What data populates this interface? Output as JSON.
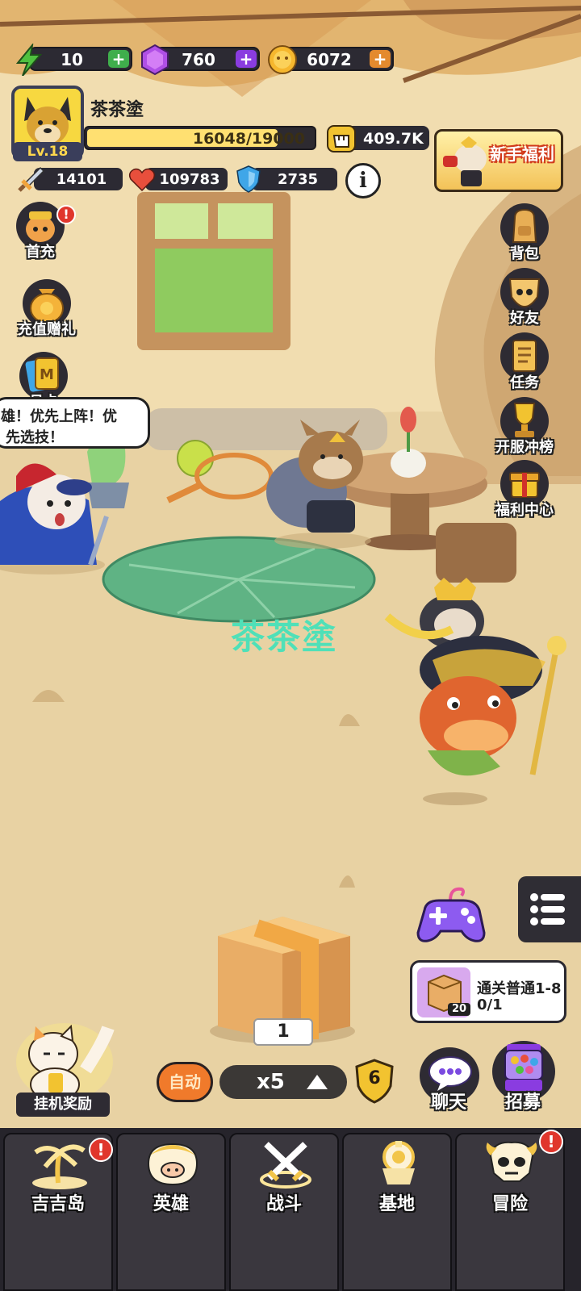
{
  "resources": {
    "energy": {
      "value": "10",
      "icon": "lightning-icon",
      "plus_color": "#3fae4c"
    },
    "gems": {
      "value": "760",
      "icon": "purple-gem-icon",
      "plus_color": "#8a3ce0"
    },
    "coins": {
      "value": "6072",
      "icon": "gold-coin-icon",
      "plus_color": "#e48a2e"
    },
    "plus": "+"
  },
  "player": {
    "name": "茶茶塗",
    "level": "Lv.18",
    "xp_text": "16048/19000",
    "xp_current": 16048,
    "xp_max": 19000,
    "power": "409.7K",
    "attack": "14101",
    "hp": "109783",
    "defense": "2735",
    "info": "i"
  },
  "newbie_banner": "新手福利",
  "left_menu": [
    {
      "label": "首充",
      "icon": "first-charge-icon",
      "alert": "!"
    },
    {
      "label": "充值赠礼",
      "icon": "money-bag-icon"
    },
    {
      "label": "月卡",
      "icon": "month-card-icon",
      "card_letter": "M"
    }
  ],
  "right_menu": [
    {
      "label": "背包",
      "icon": "backpack-icon"
    },
    {
      "label": "好友",
      "icon": "friends-icon"
    },
    {
      "label": "任务",
      "icon": "tasks-icon"
    },
    {
      "label": "开服冲榜",
      "icon": "trophy-icon"
    },
    {
      "label": "福利中心",
      "icon": "gift-icon"
    }
  ],
  "speech": {
    "line1": "雄！优先上阵！优",
    "line2": "先选技！"
  },
  "center_name": "茶茶塗",
  "crate": {
    "count": "1"
  },
  "controls": {
    "auto": "自动",
    "speed": "x5",
    "stage": "6"
  },
  "quest": {
    "title": "通关普通1-8",
    "progress": "0/1",
    "reward_count": "20"
  },
  "idle_reward": "挂机奖励",
  "chat": "聊天",
  "recruit": "招募",
  "bottom_nav": [
    {
      "label": "吉吉岛",
      "icon": "palm-island-icon",
      "alert": "!"
    },
    {
      "label": "英雄",
      "icon": "hero-pig-icon"
    },
    {
      "label": "战斗",
      "icon": "crossed-swords-icon"
    },
    {
      "label": "基地",
      "icon": "base-tower-icon"
    },
    {
      "label": "冒险",
      "icon": "skull-adventure-icon",
      "alert": "!"
    }
  ]
}
